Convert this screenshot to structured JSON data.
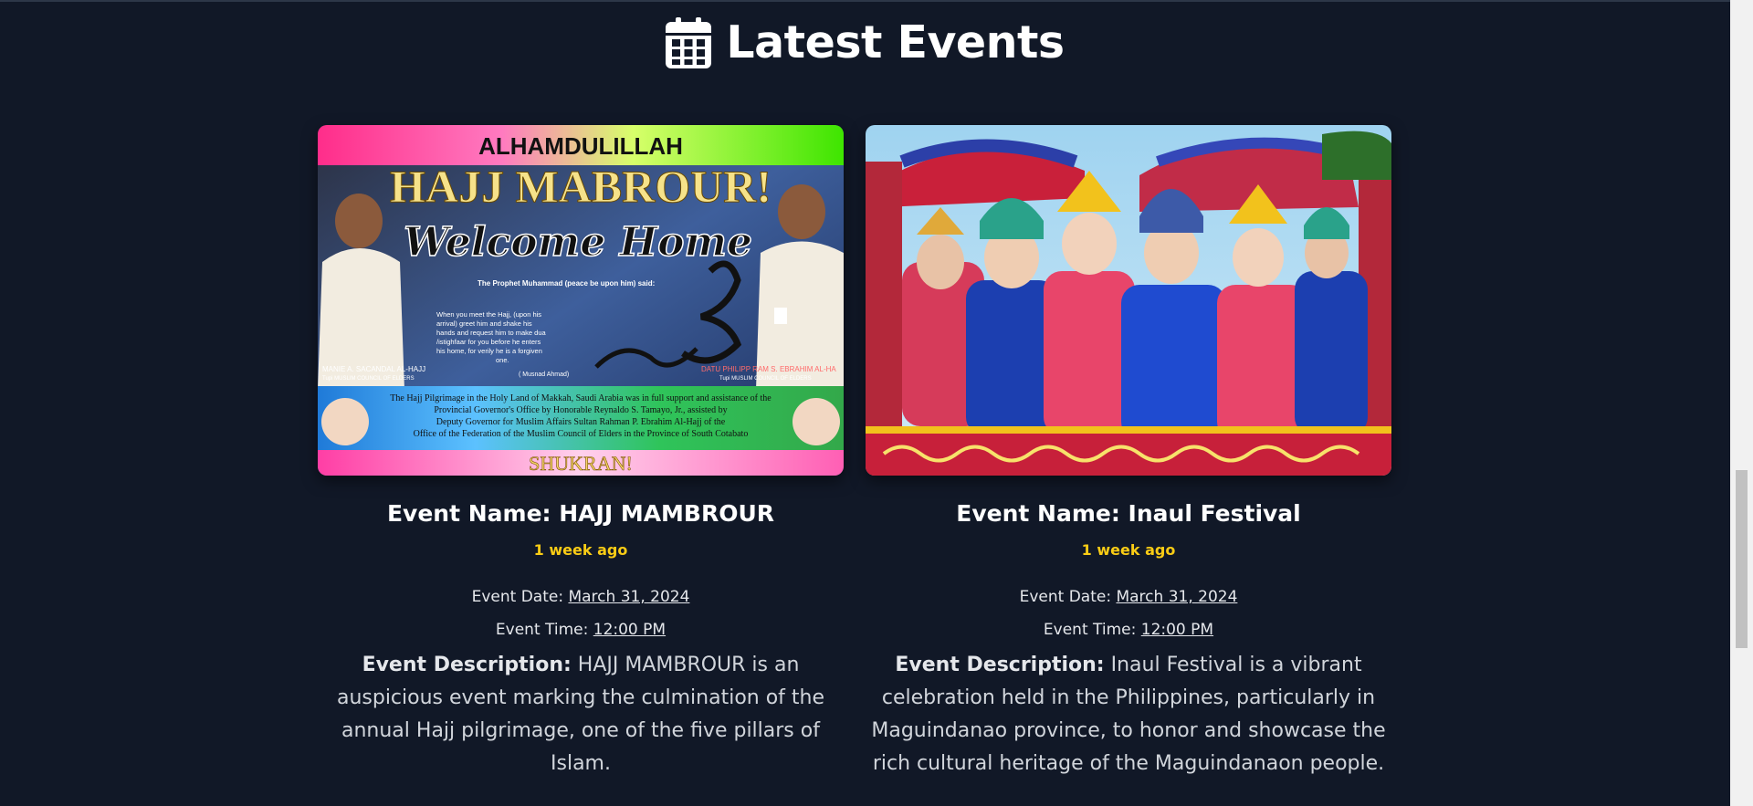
{
  "section": {
    "title": "Latest Events",
    "icon": "calendar-icon"
  },
  "events": [
    {
      "name_label": "Event Name:",
      "name": "HAJJ MAMBROUR",
      "ago": "1 week ago",
      "date_label": "Event Date:",
      "date": "March 31, 2024",
      "time_label": "Event Time:",
      "time": "12:00 PM",
      "desc_label": "Event Description:",
      "description": "HAJJ MAMBROUR is an auspicious event marking the culmination of the annual Hajj pilgrimage, one of the five pillars of Islam.",
      "poster": {
        "top": "ALHAMDULILLAH",
        "headline": "HAJJ MABROUR!",
        "script": "Welcome Home",
        "quote_title": "The Prophet Muhammad (peace be upon him) said:",
        "quote": "When you meet the Hajj, (upon his arrival) greet him and shake his hands and request him to make dua /istighfaar for you before he enters his home, for verily he is a forgiven one.",
        "source": "( Musnad Ahmad)",
        "left_name": "MANIE A. SACANDAL AL-HAJJ",
        "left_org": "Tupi MUSLIM COUNCIL OF ELDERS",
        "right_name": "DATU PHILIPP RAM S. EBRAHIM AL-HA",
        "right_org": "Tupi MUSLIM COUNCIL OF ELDERS",
        "banner": "The Hajj Pilgrimage in the Holy Land of Makkah, Saudi Arabia was in full support and assistance of the Provincial Governor's Office by Honorable Reynaldo S. Tamayo, Jr., assisted by Deputy Governor for Muslim Affairs Sultan Rahman P. Ebrahim Al-Hajj of the Office of the Federation of the Muslim Council of Elders in the Province of South Cotabato",
        "footer": "SHUKRAN!"
      }
    },
    {
      "name_label": "Event Name:",
      "name": "Inaul Festival",
      "ago": "1 week ago",
      "date_label": "Event Date:",
      "date": "March 31, 2024",
      "time_label": "Event Time:",
      "time": "12:00 PM",
      "desc_label": "Event Description:",
      "description": "Inaul Festival is a vibrant celebration held in the Philippines, particularly in Maguindanao province, to honor and showcase the rich cultural heritage of the Maguindanaon people."
    }
  ],
  "colors": {
    "background": "#111827",
    "accent": "#facc15"
  }
}
